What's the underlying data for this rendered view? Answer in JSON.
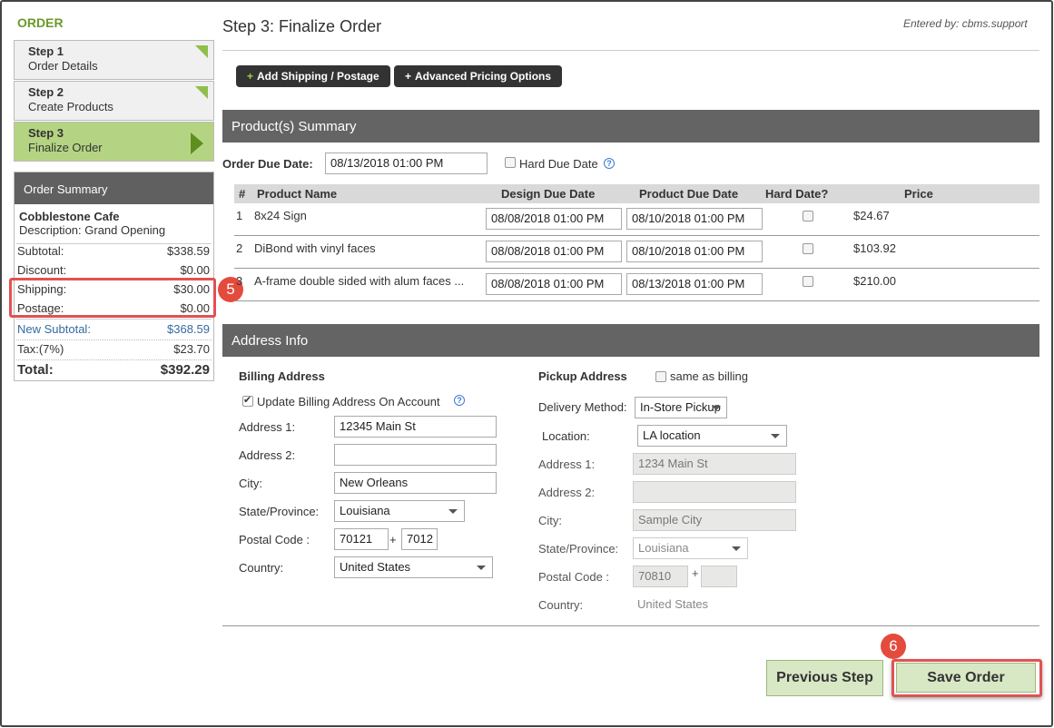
{
  "sidebar": {
    "heading": "ORDER",
    "steps": [
      {
        "num": "Step 1",
        "name": "Order Details"
      },
      {
        "num": "Step 2",
        "name": "Create Products"
      },
      {
        "num": "Step 3",
        "name": "Finalize Order"
      }
    ],
    "summary": {
      "title": "Order Summary",
      "customer": "Cobblestone Cafe",
      "description": "Description:  Grand Opening",
      "rows": [
        {
          "label": "Subtotal:",
          "value": "$338.59"
        },
        {
          "label": "Discount:",
          "value": "$0.00"
        },
        {
          "label": "Shipping:",
          "value": "$30.00"
        },
        {
          "label": "Postage:",
          "value": "$0.00"
        },
        {
          "label": "New Subtotal:",
          "value": "$368.59"
        },
        {
          "label": "Tax:(7%)",
          "value": "$23.70"
        },
        {
          "label": "Total:",
          "value": "$392.29"
        }
      ]
    }
  },
  "callouts": {
    "shipping": "5",
    "save": "6"
  },
  "header": {
    "title": "Step 3: Finalize Order",
    "entered_by": "Entered by: cbms.support"
  },
  "toolbar": {
    "add_shipping": "Add Shipping / Postage",
    "advanced_pricing": "Advanced Pricing Options",
    "plus": "+"
  },
  "products": {
    "section_title": "Product(s) Summary",
    "due_label": "Order Due Date:",
    "due_value": "08/13/2018 01:00 PM",
    "hard_due_label": "Hard Due Date",
    "columns": [
      "#",
      "Product Name",
      "Design Due Date",
      "Product Due Date",
      "Hard Date?",
      "Price"
    ],
    "rows": [
      {
        "num": "1",
        "name": "8x24 Sign",
        "design_due": "08/08/2018 01:00 PM",
        "product_due": "08/10/2018 01:00 PM",
        "hard": false,
        "price": "$24.67"
      },
      {
        "num": "2",
        "name": "DiBond with vinyl faces",
        "design_due": "08/08/2018 01:00 PM",
        "product_due": "08/10/2018 01:00 PM",
        "hard": false,
        "price": "$103.92"
      },
      {
        "num": "3",
        "name": "A-frame double sided with alum faces ...",
        "design_due": "08/08/2018 01:00 PM",
        "product_due": "08/13/2018 01:00 PM",
        "hard": false,
        "price": "$210.00"
      }
    ]
  },
  "address": {
    "section_title": "Address Info",
    "billing": {
      "heading": "Billing Address",
      "update_label": "Update Billing Address On Account",
      "update_checked": true,
      "address1_label": "Address 1:",
      "address1": "12345 Main St",
      "address2_label": "Address 2:",
      "address2": "",
      "city_label": "City:",
      "city": "New Orleans",
      "state_label": "State/Province:",
      "state": "Louisiana",
      "postal_label": "Postal Code :",
      "postal": "70121",
      "postal_ext": "7012",
      "postal_sep": "+",
      "country_label": "Country:",
      "country": "United States"
    },
    "pickup": {
      "heading": "Pickup Address",
      "same_label": "same as billing",
      "same_checked": false,
      "delivery_label": "Delivery Method:",
      "delivery": "In-Store Pickup",
      "location_label": "Location:",
      "location": "LA location",
      "address1_label": "Address 1:",
      "address1": "1234 Main St",
      "address2_label": "Address 2:",
      "address2": "",
      "city_label": "City:",
      "city": "Sample City",
      "state_label": "State/Province:",
      "state": "Louisiana",
      "postal_label": "Postal Code :",
      "postal": "70810",
      "postal_ext": "",
      "postal_sep": "+",
      "country_label": "Country:",
      "country": "United States"
    }
  },
  "footer": {
    "previous": "Previous Step",
    "save": "Save Order"
  }
}
